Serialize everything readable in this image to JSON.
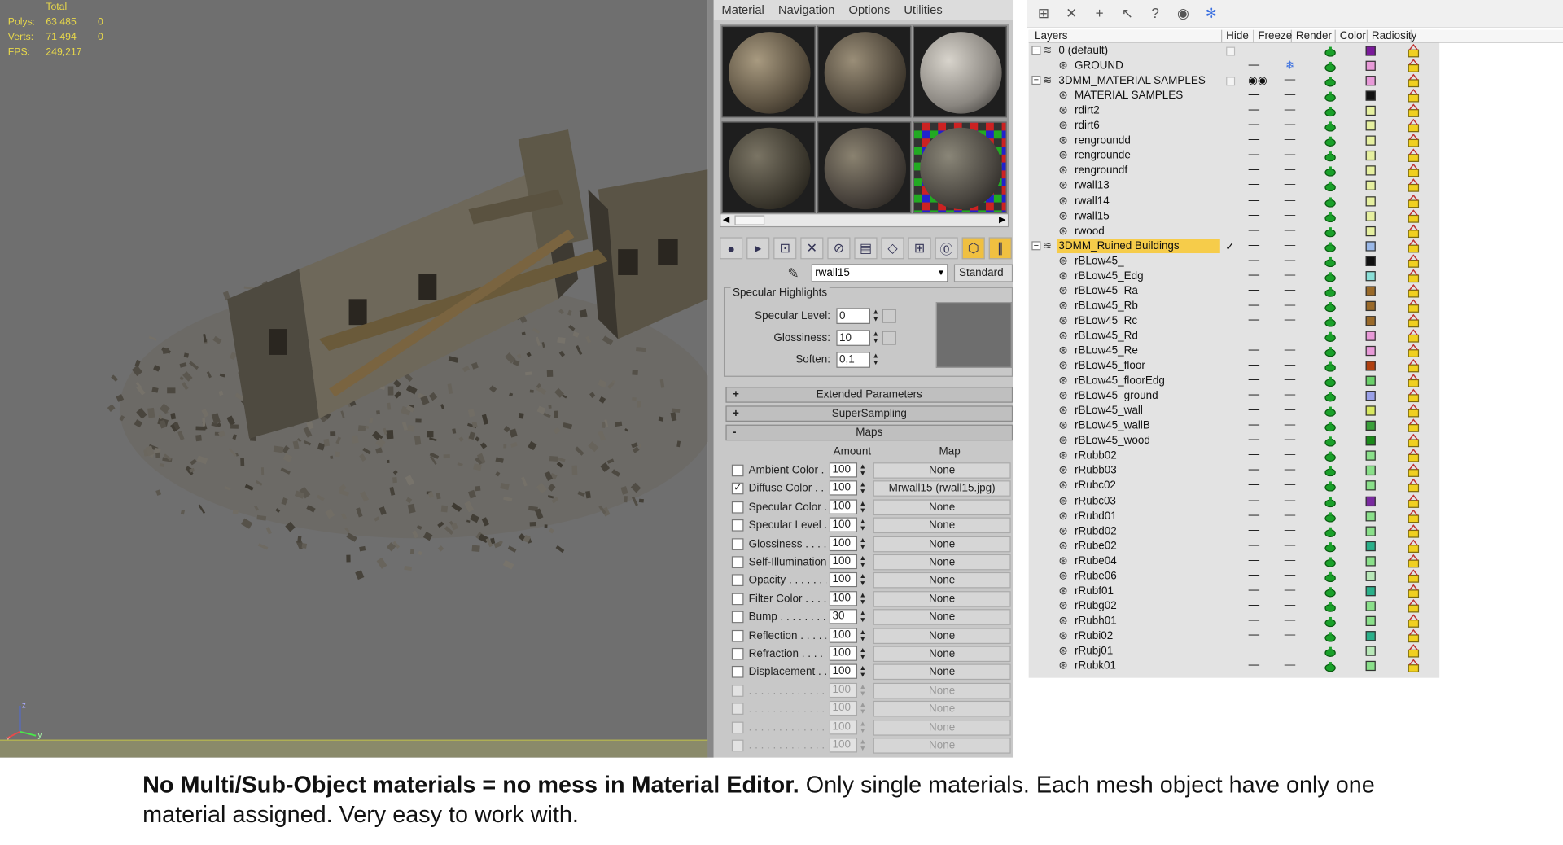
{
  "viewport": {
    "stats": [
      {
        "label": "",
        "v1": "Total",
        "v2": ""
      },
      {
        "label": "Polys:",
        "v1": "63 485",
        "v2": "0"
      },
      {
        "label": "Verts:",
        "v1": "71 494",
        "v2": "0"
      },
      {
        "label": "",
        "v1": "",
        "v2": ""
      },
      {
        "label": "FPS:",
        "v1": "249,217",
        "v2": ""
      }
    ],
    "axis": {
      "z": "z",
      "x": "x",
      "y": "y"
    }
  },
  "material_editor": {
    "menu": [
      "Material",
      "Navigation",
      "Options",
      "Utilities"
    ],
    "material_name": "rwall15",
    "material_type": "Standard",
    "specular": {
      "title": "Specular Highlights",
      "specular_level_label": "Specular Level:",
      "specular_level": "0",
      "glossiness_label": "Glossiness:",
      "glossiness": "10",
      "soften_label": "Soften:",
      "soften": "0,1"
    },
    "rollouts": {
      "extended": "Extended Parameters",
      "supersampling": "SuperSampling",
      "maps": "Maps"
    },
    "maps_header": {
      "amount": "Amount",
      "map": "Map"
    },
    "maps": [
      {
        "name": "Ambient Color . .",
        "amount": "100",
        "map": "None",
        "checked": false
      },
      {
        "name": "Diffuse Color . . . .",
        "amount": "100",
        "map": "Mrwall15 (rwall15.jpg)",
        "checked": true
      },
      {
        "name": "Specular Color . .",
        "amount": "100",
        "map": "None",
        "checked": false
      },
      {
        "name": "Specular Level . .",
        "amount": "100",
        "map": "None",
        "checked": false
      },
      {
        "name": "Glossiness . . . . .",
        "amount": "100",
        "map": "None",
        "checked": false
      },
      {
        "name": "Self-Illumination .",
        "amount": "100",
        "map": "None",
        "checked": false
      },
      {
        "name": "Opacity . . . . . . . .",
        "amount": "100",
        "map": "None",
        "checked": false
      },
      {
        "name": "Filter Color . . . . .",
        "amount": "100",
        "map": "None",
        "checked": false
      },
      {
        "name": "Bump . . . . . . . . .",
        "amount": "30",
        "map": "None",
        "checked": false
      },
      {
        "name": "Reflection . . . . .",
        "amount": "100",
        "map": "None",
        "checked": false
      },
      {
        "name": "Refraction . . . . .",
        "amount": "100",
        "map": "None",
        "checked": false
      },
      {
        "name": "Displacement . .",
        "amount": "100",
        "map": "None",
        "checked": false
      },
      {
        "name": ". . . . . . . . . . . . . .",
        "amount": "100",
        "map": "None",
        "checked": false,
        "disabled": true
      },
      {
        "name": ". . . . . . . . . . . . . .",
        "amount": "100",
        "map": "None",
        "checked": false,
        "disabled": true
      },
      {
        "name": ". . . . . . . . . . . . . .",
        "amount": "100",
        "map": "None",
        "checked": false,
        "disabled": true
      },
      {
        "name": ". . . . . . . . . . . . . .",
        "amount": "100",
        "map": "None",
        "checked": false,
        "disabled": true
      }
    ]
  },
  "layer_manager": {
    "columns": [
      "Layers",
      "Hide",
      "Freeze",
      "Render",
      "Color",
      "Radiosity"
    ],
    "rows": [
      {
        "name": "0 (default)",
        "level": 0,
        "kind": "layer",
        "color": "#7a1a9a",
        "freeze": "—",
        "hide": "—"
      },
      {
        "name": "GROUND",
        "level": 1,
        "kind": "object",
        "color": "#e89ad8",
        "freeze": "❄",
        "hide": "—"
      },
      {
        "name": "3DMM_MATERIAL SAMPLES",
        "level": 0,
        "kind": "layer",
        "color": "#e89ad8",
        "freeze": "—",
        "hide": "◉◉"
      },
      {
        "name": "MATERIAL SAMPLES",
        "level": 1,
        "kind": "object",
        "color": "#111111",
        "freeze": "—",
        "hide": "—"
      },
      {
        "name": "rdirt2",
        "level": 1,
        "kind": "object",
        "color": "#e6f0a0",
        "freeze": "—",
        "hide": "—"
      },
      {
        "name": "rdirt6",
        "level": 1,
        "kind": "object",
        "color": "#e6f0a0",
        "freeze": "—",
        "hide": "—"
      },
      {
        "name": "rengroundd",
        "level": 1,
        "kind": "object",
        "color": "#e6f0a0",
        "freeze": "—",
        "hide": "—"
      },
      {
        "name": "rengrounde",
        "level": 1,
        "kind": "object",
        "color": "#e6f0a0",
        "freeze": "—",
        "hide": "—"
      },
      {
        "name": "rengroundf",
        "level": 1,
        "kind": "object",
        "color": "#e6f0a0",
        "freeze": "—",
        "hide": "—"
      },
      {
        "name": "rwall13",
        "level": 1,
        "kind": "object",
        "color": "#e6f0a0",
        "freeze": "—",
        "hide": "—"
      },
      {
        "name": "rwall14",
        "level": 1,
        "kind": "object",
        "color": "#e6f0a0",
        "freeze": "—",
        "hide": "—"
      },
      {
        "name": "rwall15",
        "level": 1,
        "kind": "object",
        "color": "#e6f0a0",
        "freeze": "—",
        "hide": "—"
      },
      {
        "name": "rwood",
        "level": 1,
        "kind": "object",
        "color": "#e6f0a0",
        "freeze": "—",
        "hide": "—"
      },
      {
        "name": "3DMM_Ruined Buildings",
        "level": 0,
        "kind": "layer",
        "color": "#9ab8e8",
        "freeze": "—",
        "hide": "—",
        "selected": true,
        "current": true
      },
      {
        "name": "rBLow45_",
        "level": 1,
        "kind": "object",
        "color": "#111111",
        "freeze": "—",
        "hide": "—"
      },
      {
        "name": "rBLow45_Edg",
        "level": 1,
        "kind": "object",
        "color": "#8ae0d8",
        "freeze": "—",
        "hide": "—"
      },
      {
        "name": "rBLow45_Ra",
        "level": 1,
        "kind": "object",
        "color": "#9a6a2a",
        "freeze": "—",
        "hide": "—"
      },
      {
        "name": "rBLow45_Rb",
        "level": 1,
        "kind": "object",
        "color": "#9a6a2a",
        "freeze": "—",
        "hide": "—"
      },
      {
        "name": "rBLow45_Rc",
        "level": 1,
        "kind": "object",
        "color": "#9a6a2a",
        "freeze": "—",
        "hide": "—"
      },
      {
        "name": "rBLow45_Rd",
        "level": 1,
        "kind": "object",
        "color": "#e89ad8",
        "freeze": "—",
        "hide": "—"
      },
      {
        "name": "rBLow45_Re",
        "level": 1,
        "kind": "object",
        "color": "#e89ad8",
        "freeze": "—",
        "hide": "—"
      },
      {
        "name": "rBLow45_floor",
        "level": 1,
        "kind": "object",
        "color": "#b04010",
        "freeze": "—",
        "hide": "—"
      },
      {
        "name": "rBLow45_floorEdg",
        "level": 1,
        "kind": "object",
        "color": "#6ad06a",
        "freeze": "—",
        "hide": "—"
      },
      {
        "name": "rBLow45_ground",
        "level": 1,
        "kind": "object",
        "color": "#9aa0e8",
        "freeze": "—",
        "hide": "—"
      },
      {
        "name": "rBLow45_wall",
        "level": 1,
        "kind": "object",
        "color": "#d8e860",
        "freeze": "—",
        "hide": "—"
      },
      {
        "name": "rBLow45_wallB",
        "level": 1,
        "kind": "object",
        "color": "#3aa03a",
        "freeze": "—",
        "hide": "—"
      },
      {
        "name": "rBLow45_wood",
        "level": 1,
        "kind": "object",
        "color": "#1a8a1a",
        "freeze": "—",
        "hide": "—"
      },
      {
        "name": "rRubb02",
        "level": 1,
        "kind": "object",
        "color": "#8ae08a",
        "freeze": "—",
        "hide": "—"
      },
      {
        "name": "rRubb03",
        "level": 1,
        "kind": "object",
        "color": "#8ae08a",
        "freeze": "—",
        "hide": "—"
      },
      {
        "name": "rRubc02",
        "level": 1,
        "kind": "object",
        "color": "#8ae08a",
        "freeze": "—",
        "hide": "—"
      },
      {
        "name": "rRubc03",
        "level": 1,
        "kind": "object",
        "color": "#7a2aa0",
        "freeze": "—",
        "hide": "—"
      },
      {
        "name": "rRubd01",
        "level": 1,
        "kind": "object",
        "color": "#8ae08a",
        "freeze": "—",
        "hide": "—"
      },
      {
        "name": "rRubd02",
        "level": 1,
        "kind": "object",
        "color": "#8ae08a",
        "freeze": "—",
        "hide": "—"
      },
      {
        "name": "rRube02",
        "level": 1,
        "kind": "object",
        "color": "#2ab08a",
        "freeze": "—",
        "hide": "—"
      },
      {
        "name": "rRube04",
        "level": 1,
        "kind": "object",
        "color": "#8ae08a",
        "freeze": "—",
        "hide": "—"
      },
      {
        "name": "rRube06",
        "level": 1,
        "kind": "object",
        "color": "#b8e8b8",
        "freeze": "—",
        "hide": "—"
      },
      {
        "name": "rRubf01",
        "level": 1,
        "kind": "object",
        "color": "#2ab08a",
        "freeze": "—",
        "hide": "—"
      },
      {
        "name": "rRubg02",
        "level": 1,
        "kind": "object",
        "color": "#8ae08a",
        "freeze": "—",
        "hide": "—"
      },
      {
        "name": "rRubh01",
        "level": 1,
        "kind": "object",
        "color": "#8ae08a",
        "freeze": "—",
        "hide": "—"
      },
      {
        "name": "rRubi02",
        "level": 1,
        "kind": "object",
        "color": "#2ab08a",
        "freeze": "—",
        "hide": "—"
      },
      {
        "name": "rRubj01",
        "level": 1,
        "kind": "object",
        "color": "#b8e8b8",
        "freeze": "—",
        "hide": "—"
      },
      {
        "name": "rRubk01",
        "level": 1,
        "kind": "object",
        "color": "#8ae08a",
        "freeze": "—",
        "hide": "—"
      }
    ]
  },
  "caption": {
    "bold": "No Multi/Sub-Object materials = no mess in Material Editor.",
    "rest": " Only single materials. Each mesh object have only one material assigned. Very easy to work with."
  },
  "icons": {
    "toolbar": [
      "sphere-get-icon",
      "put-to-scene-icon",
      "assign-icon",
      "delete-icon",
      "make-unique-icon",
      "put-library-icon",
      "material-effects-icon",
      "show-map-icon",
      "show-end-result-icon",
      "go-to-parent-icon"
    ],
    "layer_toolbar": [
      "new-layer-icon",
      "delete-layer-icon",
      "add-selected-icon",
      "select-objects-icon",
      "highlight-icon",
      "hide-all-icon",
      "freeze-all-icon"
    ]
  }
}
